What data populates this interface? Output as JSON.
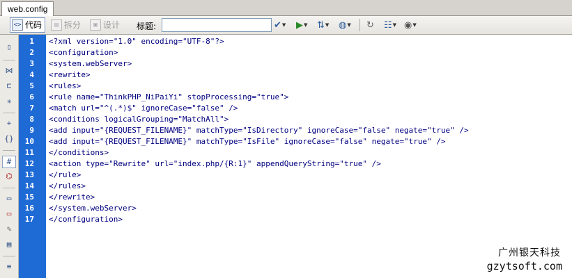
{
  "tab": {
    "title": "web.config"
  },
  "toolbar": {
    "view_code": "代码",
    "view_split": "拆分",
    "view_design": "设计",
    "title_label": "标题:",
    "title_value": ""
  },
  "editor": {
    "line_numbers": [
      "1",
      "2",
      "3",
      "4",
      "5",
      "6",
      "7",
      "8",
      "9",
      "10",
      "11",
      "12",
      "13",
      "14",
      "15",
      "16",
      "17"
    ],
    "lines": [
      "<?xml version=\"1.0\" encoding=\"UTF-8\"?>",
      "<configuration>",
      "<system.webServer>",
      "<rewrite>",
      "<rules>",
      "<rule name=\"ThinkPHP_NiPaiYi\" stopProcessing=\"true\">",
      "<match url=\"^(.*)$\" ignoreCase=\"false\" />",
      "<conditions logicalGrouping=\"MatchAll\">",
      "<add input=\"{REQUEST_FILENAME}\" matchType=\"IsDirectory\" ignoreCase=\"false\" negate=\"true\" />",
      "<add input=\"{REQUEST_FILENAME}\" matchType=\"IsFile\" ignoreCase=\"false\" negate=\"true\" />",
      "</conditions>",
      "<action type=\"Rewrite\" url=\"index.php/{R:1}\" appendQueryString=\"true\" />",
      "</rule>",
      "</rules>",
      "</rewrite>",
      "</system.webServer>",
      "</configuration>"
    ]
  },
  "watermark": {
    "line1": "广州银天科技",
    "line2": "gzytsoft.com"
  }
}
